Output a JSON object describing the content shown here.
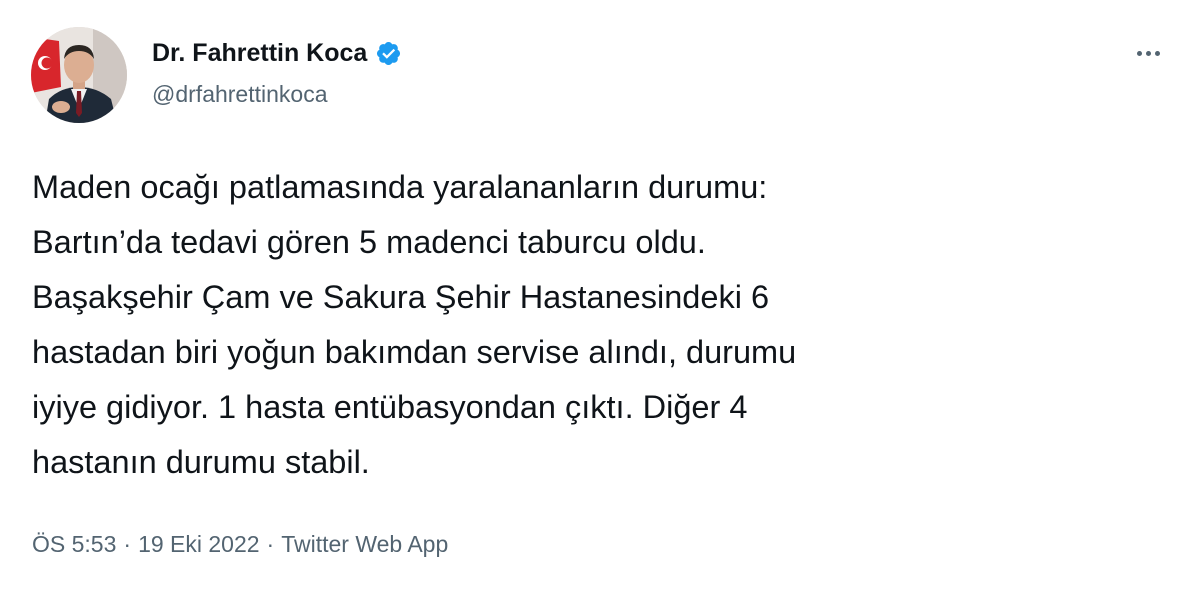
{
  "author": {
    "display_name": "Dr. Fahrettin Koca",
    "handle": "@drfahrettinkoca",
    "verified": true,
    "verified_color": "#1d9bf0"
  },
  "tweet": {
    "lines": [
      "Maden ocağı patlamasında yaralananların durumu:",
      "Bartın’da tedavi gören 5 madenci taburcu oldu.",
      "Başakşehir Çam ve Sakura Şehir Hastanesindeki 6",
      "hastadan biri yoğun bakımdan servise alındı, durumu",
      "iyiye gidiyor. 1 hasta entübasyondan çıktı. Diğer 4",
      "hastanın durumu stabil."
    ]
  },
  "meta": {
    "time": "ÖS 5:53",
    "date": "19 Eki 2022",
    "separator": "·",
    "source": "Twitter Web App"
  },
  "icons": {
    "more": "more-horizontal-icon",
    "verified": "verified-badge-icon"
  },
  "colors": {
    "text_primary": "#0f1419",
    "text_secondary": "#536471",
    "background": "#ffffff"
  }
}
